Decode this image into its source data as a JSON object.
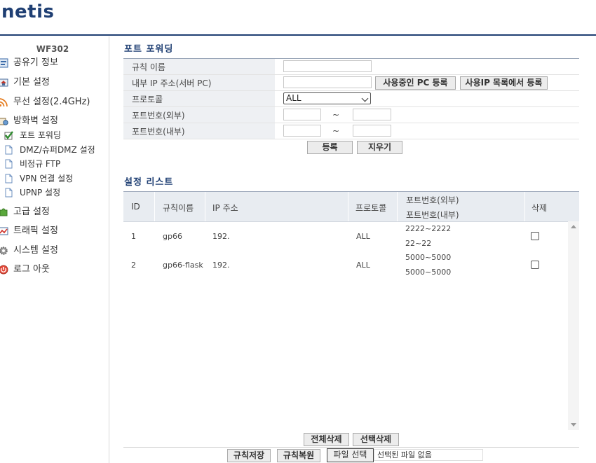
{
  "brand": {
    "logo": "netis"
  },
  "sidebar": {
    "model": "WF302",
    "items": [
      {
        "label": "공유기 정보",
        "icon": "info-icon"
      },
      {
        "label": "기본 설정",
        "icon": "home-icon"
      },
      {
        "label": "무선 설정(2.4GHz)",
        "icon": "wifi-icon"
      },
      {
        "label": "방화벽 설정",
        "icon": "firewall-icon"
      },
      {
        "label": "고급 설정",
        "icon": "puzzle-icon"
      },
      {
        "label": "트래픽 설정",
        "icon": "traffic-icon"
      },
      {
        "label": "시스템 설정",
        "icon": "gear-icon"
      },
      {
        "label": "로그 아웃",
        "icon": "power-icon"
      }
    ],
    "sub_items": [
      {
        "label": "포트 포워딩",
        "icon": "check-icon",
        "active": true
      },
      {
        "label": "DMZ/슈퍼DMZ 설정",
        "icon": "document-icon"
      },
      {
        "label": "비정규 FTP",
        "icon": "document-icon"
      },
      {
        "label": "VPN 연결 설정",
        "icon": "document-icon"
      },
      {
        "label": "UPNP 설정",
        "icon": "document-icon"
      }
    ]
  },
  "port_forwarding": {
    "title": "포트 포워딩",
    "fields": {
      "rule_name": {
        "label": "규칙 이름",
        "value": ""
      },
      "internal_ip": {
        "label": "내부 IP 주소(서버 PC)",
        "value": ""
      },
      "protocol": {
        "label": "프로토콜",
        "value": "ALL"
      },
      "external_port": {
        "label": "포트번호(외부)",
        "from": "",
        "to": ""
      },
      "internal_port": {
        "label": "포트번호(내부)",
        "from": "",
        "to": ""
      }
    },
    "tilde": "~",
    "buttons": {
      "register_pc": "사용중인 PC 등록",
      "register_from_list": "사용IP 목록에서 등록",
      "register": "등록",
      "clear": "지우기"
    }
  },
  "settings_list": {
    "title": "설정 리스트",
    "headers": {
      "id": "ID",
      "name": "규칙이름",
      "ip": "IP 주소",
      "protocol": "프로토콜",
      "port_ext": "포트번호(외부)",
      "port_int": "포트번호(내부)",
      "delete": "삭제"
    },
    "rows": [
      {
        "id": "1",
        "name": "gp66",
        "ip": "192.",
        "protocol": "ALL",
        "port_ext": "2222~2222",
        "port_int": "22~22"
      },
      {
        "id": "2",
        "name": "gp66-flask",
        "ip": "192.",
        "protocol": "ALL",
        "port_ext": "5000~5000",
        "port_int": "5000~5000"
      }
    ],
    "buttons": {
      "delete_all": "전체삭제",
      "delete_selected": "선택삭제"
    }
  },
  "footer": {
    "save_rules": "규칙저장",
    "restore_rules": "규칙복원",
    "choose_file": "파일 선택",
    "no_file": "선택된 파일 없음"
  },
  "colors": {
    "brand": "#1f3f73",
    "label_bg": "#eef0f3",
    "header_bg": "#e8ecf1"
  }
}
